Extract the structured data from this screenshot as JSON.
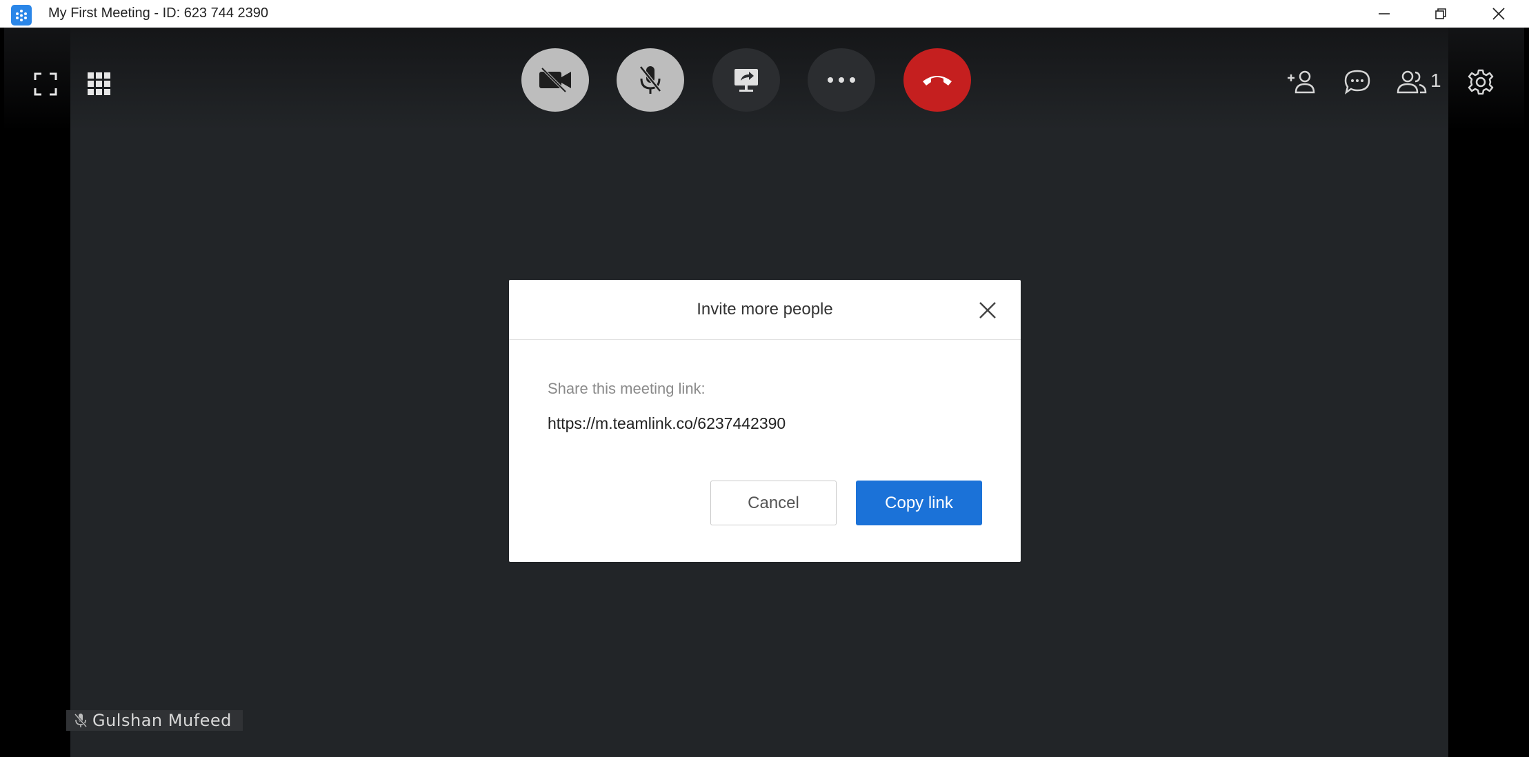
{
  "window": {
    "title": "My First Meeting - ID: 623 744 2390",
    "app_icon": "teamlink-logo-icon",
    "controls": [
      "minimize-icon",
      "restore-icon",
      "close-icon"
    ]
  },
  "toolbar": {
    "left": [
      "fullscreen-icon",
      "grid-view-icon"
    ],
    "center": [
      {
        "name": "camera-off-button",
        "icon": "video-off-icon",
        "state": "off"
      },
      {
        "name": "mute-button",
        "icon": "mic-off-icon",
        "state": "muted"
      },
      {
        "name": "share-screen-button",
        "icon": "screen-share-icon"
      },
      {
        "name": "more-button",
        "icon": "ellipsis-icon"
      },
      {
        "name": "end-call-button",
        "icon": "hang-up-icon"
      }
    ],
    "right": [
      "add-person-icon",
      "chat-icon",
      "participants-icon",
      "settings-icon"
    ],
    "participant_count": "1"
  },
  "participant": {
    "name": "Gulshan Mufeed",
    "muted_icon": "mic-off-icon"
  },
  "dialog": {
    "title": "Invite more people",
    "share_label": "Share this meeting link:",
    "link": "https://m.teamlink.co/6237442390",
    "cancel_label": "Cancel",
    "copy_label": "Copy link"
  },
  "colors": {
    "accent": "#1b72d8",
    "end_call": "#c51f1f",
    "video_bg": "#222528"
  }
}
